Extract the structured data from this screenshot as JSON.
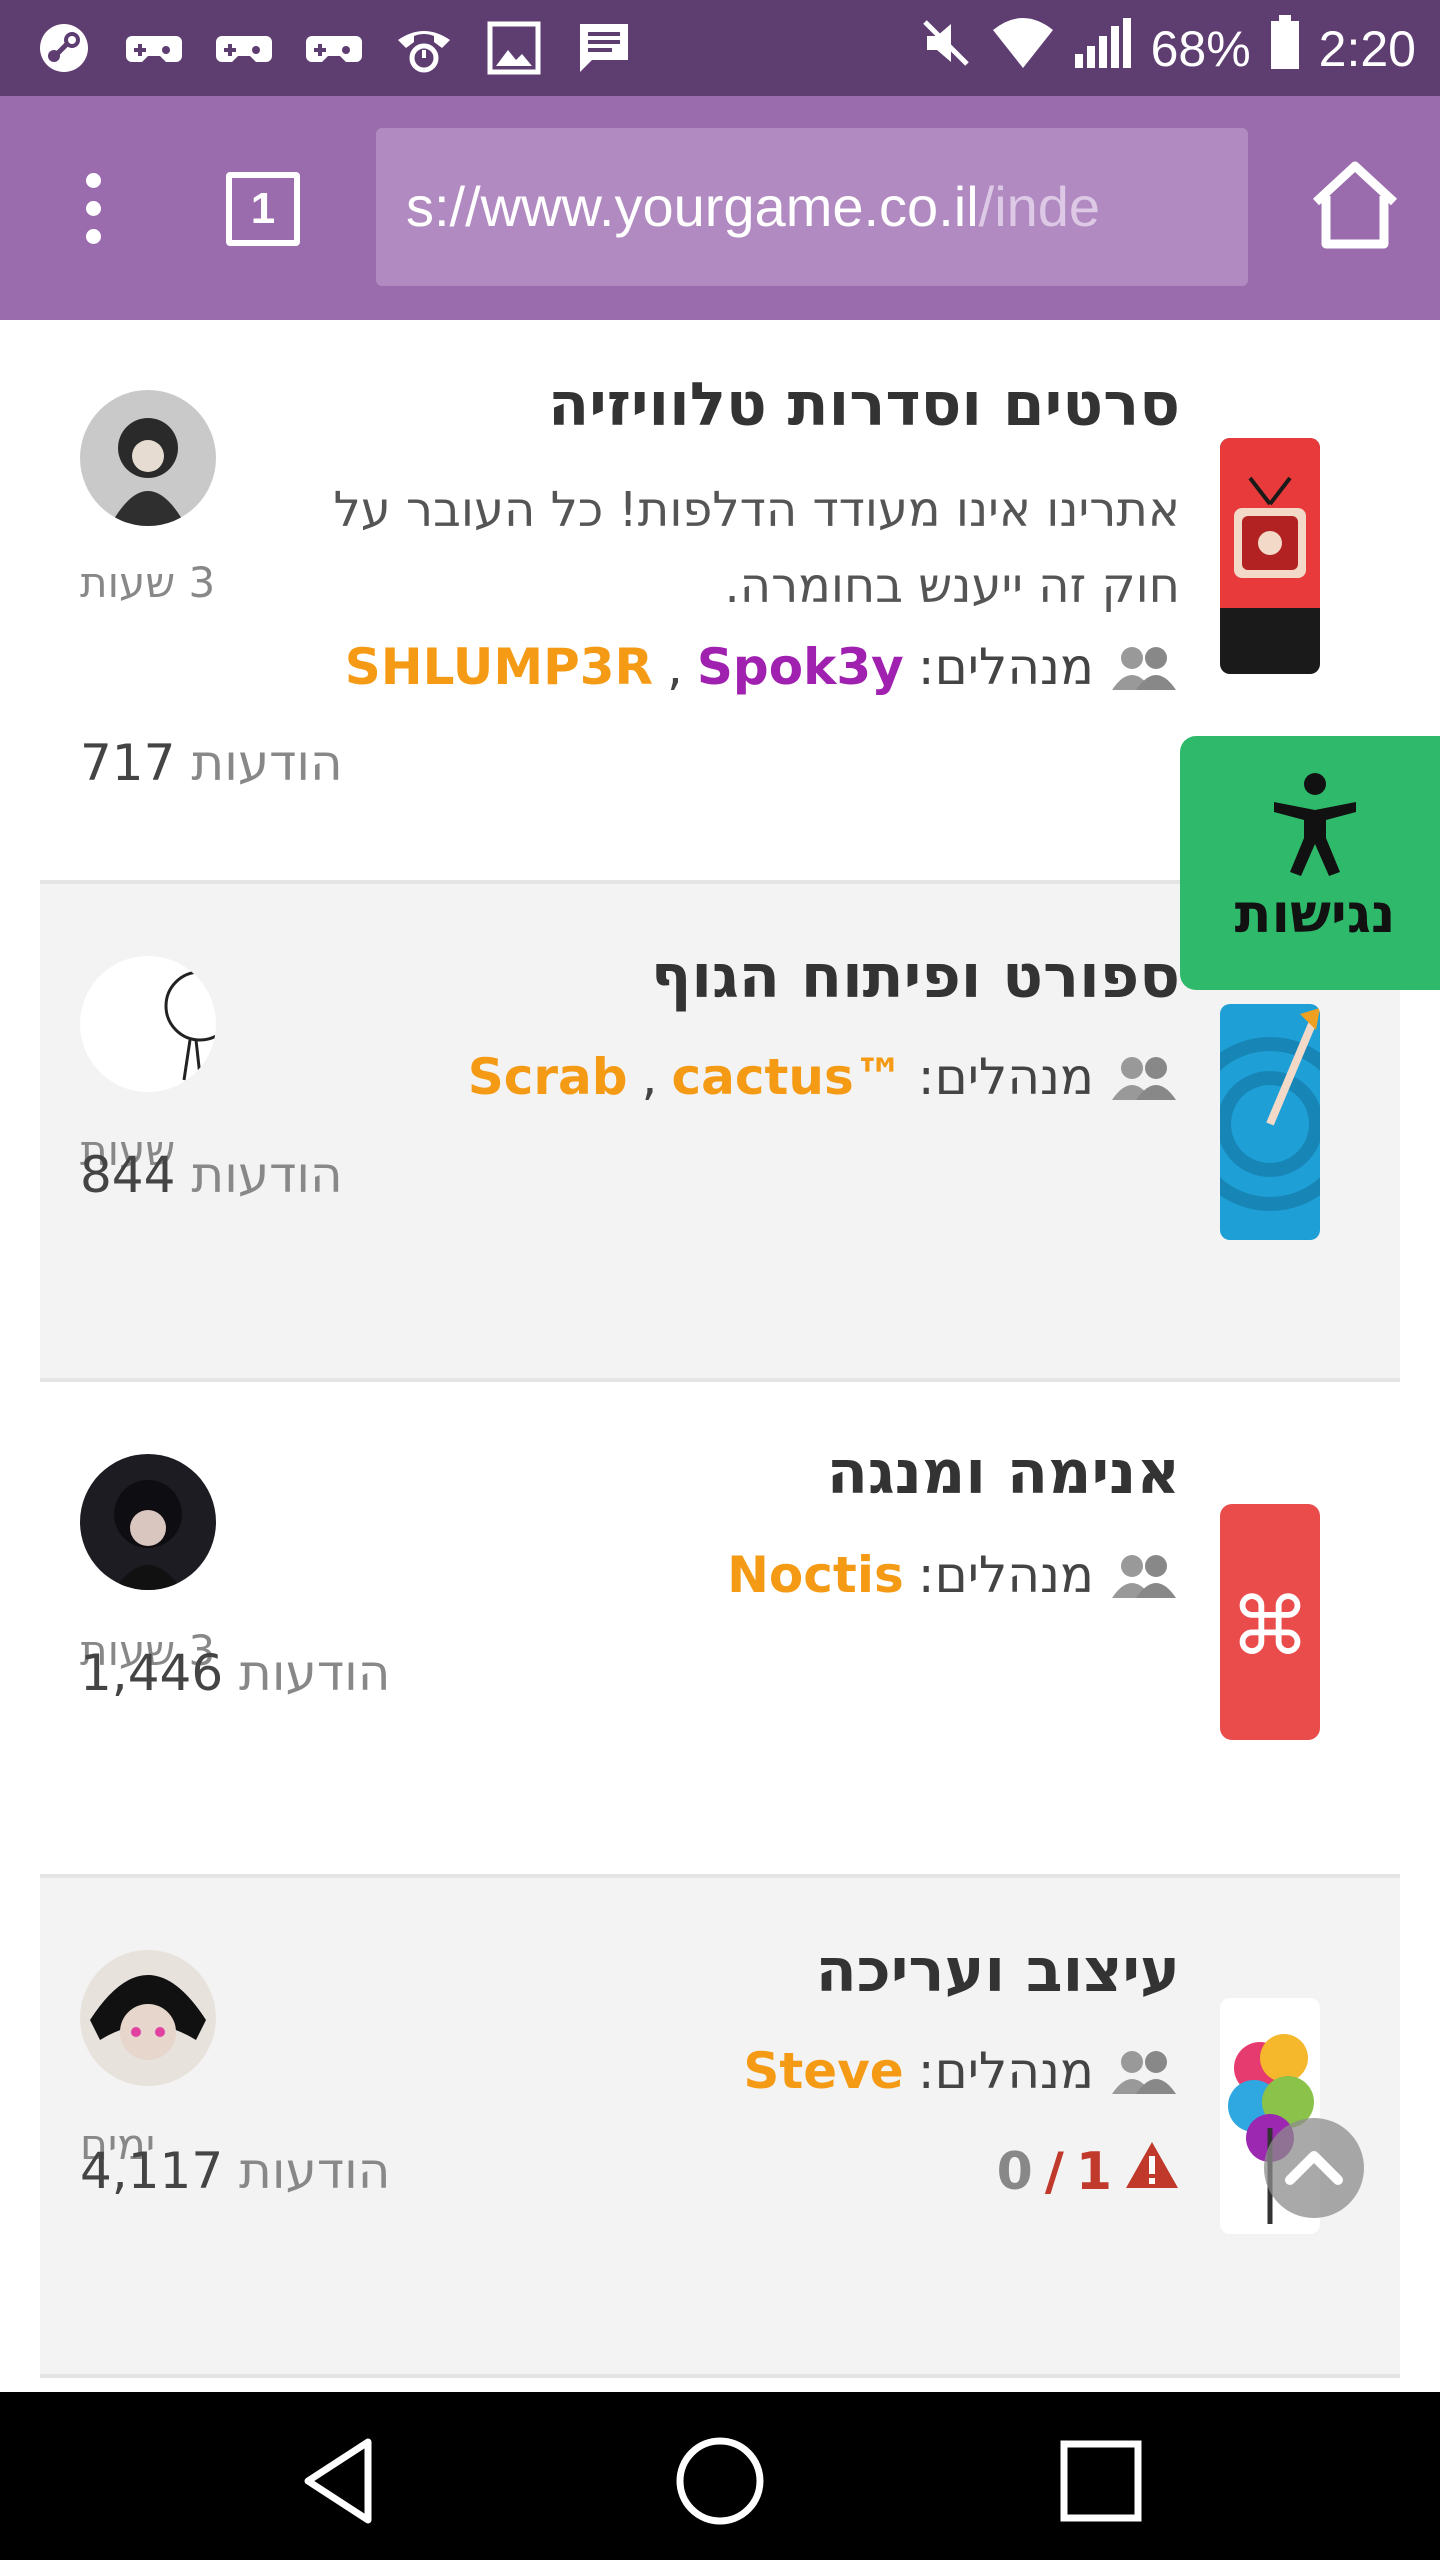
{
  "status_bar": {
    "battery": "68%",
    "time": "2:20",
    "left_icons": [
      "steam-icon",
      "game-controller-icon",
      "game-controller-icon",
      "game-controller-icon",
      "voicemail-icon",
      "image-icon",
      "message-icon"
    ],
    "right_icons": [
      "mute-icon",
      "wifi-icon",
      "signal-icon",
      "battery-icon"
    ]
  },
  "browser": {
    "url_prefix": "s://www.yourgame.co.il",
    "url_suffix": "/inde",
    "tab_count": "1",
    "icons": {
      "menu": "more-vert-icon",
      "home": "home-icon"
    }
  },
  "forums": [
    {
      "title": "סרטים וסדרות טלוויזיה",
      "description": "אתרינו אינו מעודד הדלפות! כל העובר על חוק זה ייענש בחומרה.",
      "mods_label": "מנהלים:",
      "mods": [
        {
          "name": "Spok3y",
          "color": "#a020b0"
        },
        {
          "name": "SHLUMP3R",
          "color": "#f59a14"
        }
      ],
      "last_post_time": "3 שעות",
      "post_count": "717",
      "post_label": "הודעות"
    },
    {
      "title": "ספורט ופיתוח הגוף",
      "mods_label": "מנהלים:",
      "mods": [
        {
          "name": "™cactus",
          "color": "#f59a14"
        },
        {
          "name": "Scrab",
          "color": "#f59a14"
        }
      ],
      "last_post_time": "שעות",
      "post_count": "844",
      "post_label": "הודעות"
    },
    {
      "title": "אנימה ומנגה",
      "mods_label": "מנהלים:",
      "mods": [
        {
          "name": "Noctis",
          "color": "#f59a14"
        }
      ],
      "last_post_time": "3 שעות",
      "post_count": "1,446",
      "post_label": "הודעות"
    },
    {
      "title": "עיצוב ועריכה",
      "mods_label": "מנהלים:",
      "mods": [
        {
          "name": "Steve",
          "color": "#f59a14"
        }
      ],
      "last_post_time": "ימים",
      "post_count": "4,117",
      "post_label": "הודעות",
      "warnings": {
        "current": "1",
        "separator": "/",
        "total": "0"
      }
    }
  ],
  "accessibility": {
    "label": "נגישות",
    "color": "#2fba6b"
  },
  "nav": {
    "back": "back-icon",
    "home": "home-circle-icon",
    "recents": "recents-icon"
  }
}
